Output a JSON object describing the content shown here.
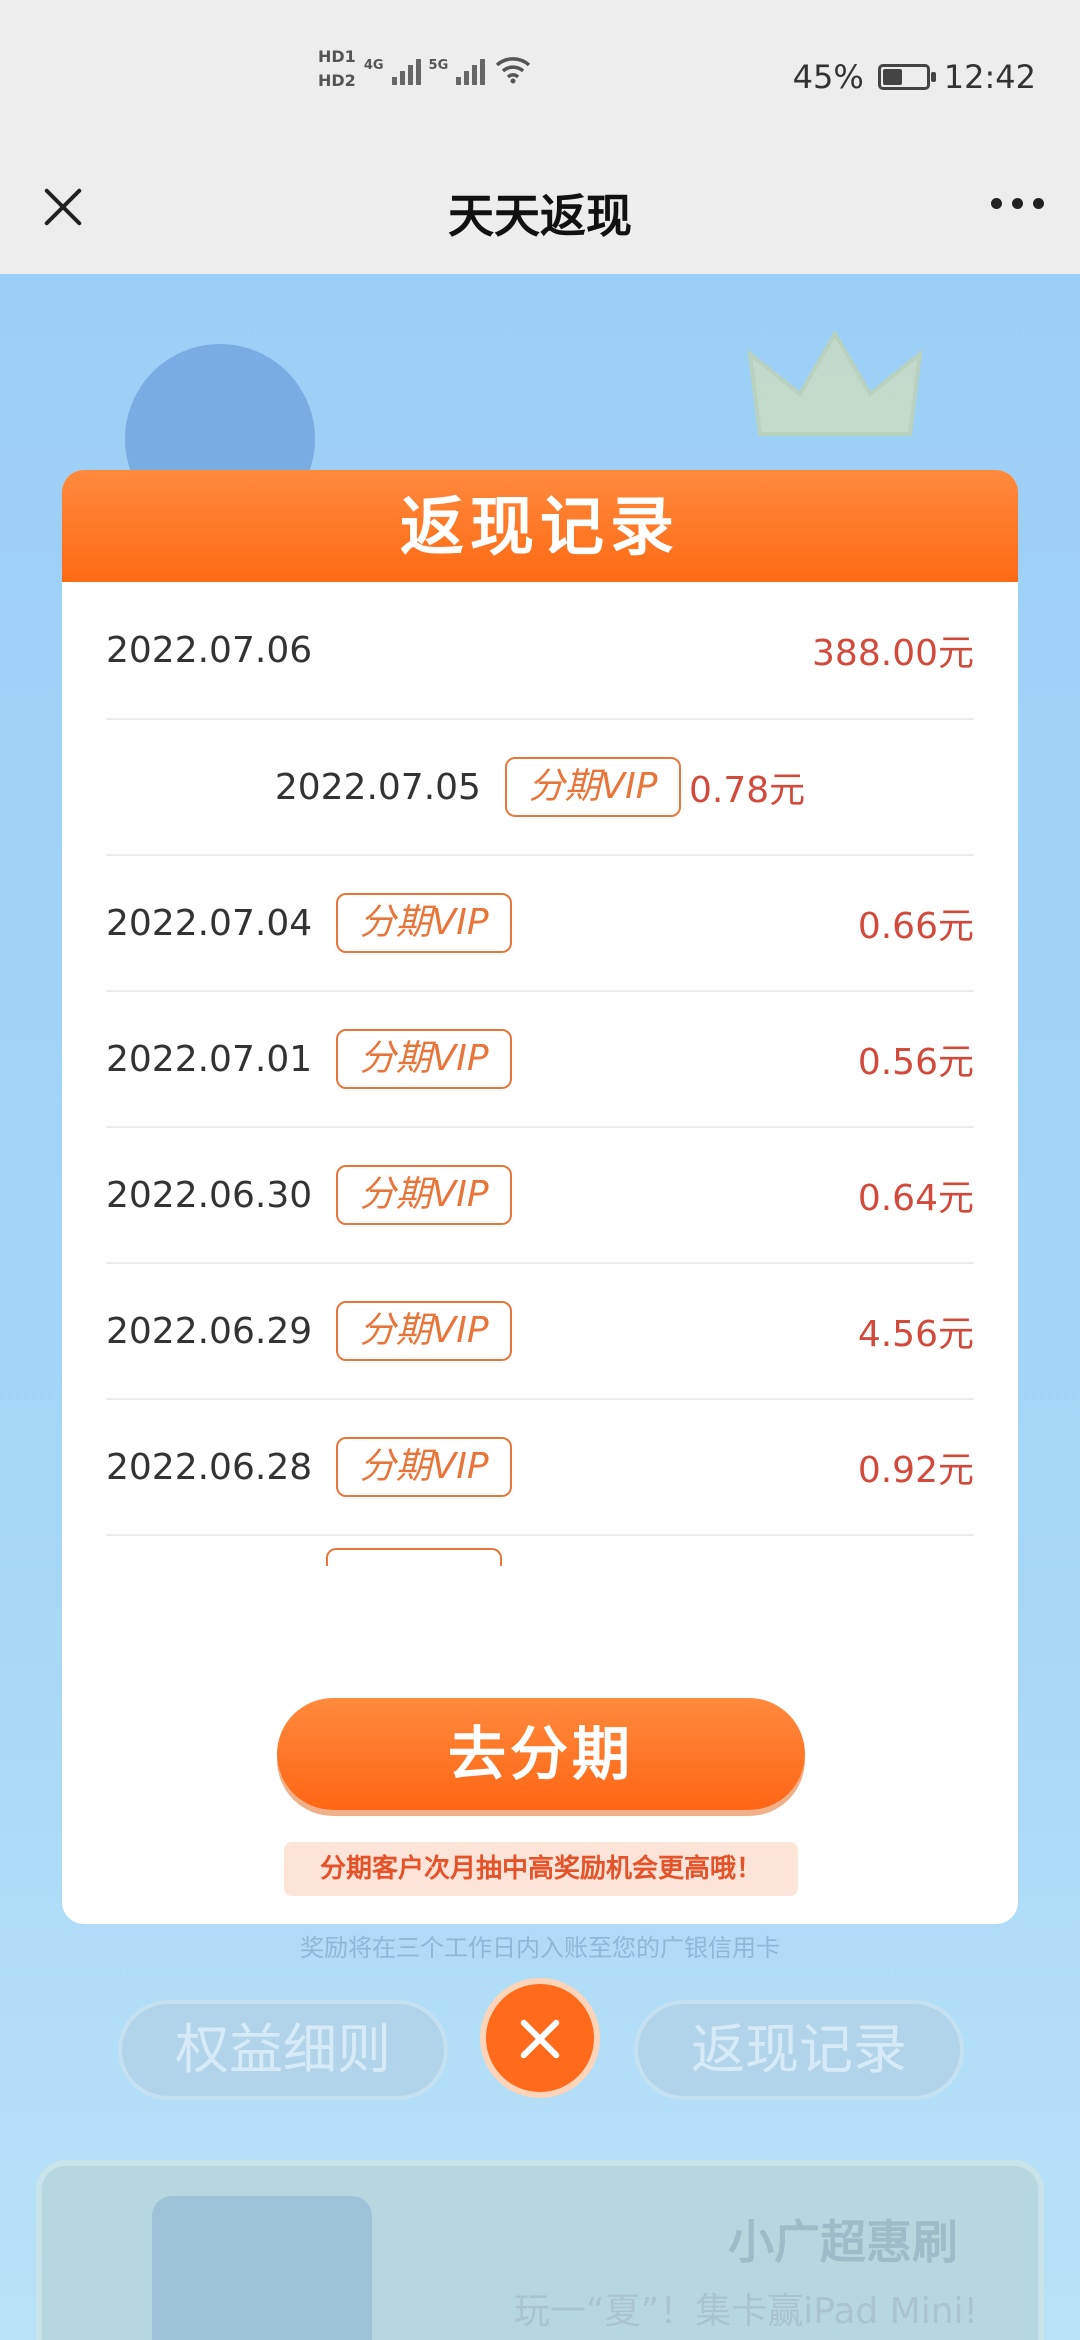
{
  "status_bar": {
    "hd1": "HD1",
    "hd2": "HD2",
    "net1": "4G",
    "net2": "5G",
    "battery_level": 0.45,
    "battery_text": "45%",
    "time": "12:42"
  },
  "title_bar": {
    "title": "天天返现",
    "close_icon": "close-icon",
    "more_icon": "more-icon"
  },
  "modal": {
    "title": "返现记录",
    "records": [
      {
        "date": "2022.07.06",
        "badge": "",
        "amount": "388.00元"
      },
      {
        "date": "2022.07.05",
        "badge": "分期VIP",
        "amount": "0.78元"
      },
      {
        "date": "2022.07.04",
        "badge": "分期VIP",
        "amount": "0.66元"
      },
      {
        "date": "2022.07.01",
        "badge": "分期VIP",
        "amount": "0.56元"
      },
      {
        "date": "2022.06.30",
        "badge": "分期VIP",
        "amount": "0.64元"
      },
      {
        "date": "2022.06.29",
        "badge": "分期VIP",
        "amount": "4.56元"
      },
      {
        "date": "2022.06.28",
        "badge": "分期VIP",
        "amount": "0.92元"
      }
    ],
    "cta": "去分期",
    "hint": "分期客户次月抽中高奖励机会更高哦！"
  },
  "background": {
    "note": "奖励将在三个工作日内入账至您的广银信用卡",
    "tab_left": "权益细则",
    "tab_right": "返现记录",
    "card_title": "小广超惠刷",
    "card_sub": "玩一“夏”！集卡赢iPad Mini!"
  },
  "colors": {
    "accent": "#ff6a14",
    "amount": "#d24a3c",
    "badge": "#e8763a"
  }
}
